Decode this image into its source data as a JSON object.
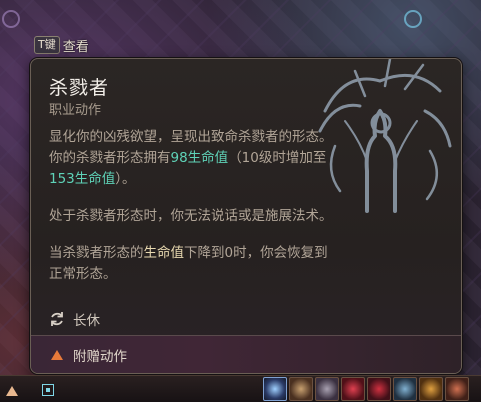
{
  "hint": {
    "key": "T键",
    "label": "查看"
  },
  "tooltip": {
    "title": "杀戮者",
    "subtitle": "职业动作",
    "desc1_a": "显化你的凶残欲望，呈现出致命杀戮者的形态。你的杀戮者形态拥有",
    "desc1_hp": "98生命值",
    "desc1_b": "（10级时增加至",
    "desc1_hp2": "153生命值",
    "desc1_c": "）。",
    "desc2": "处于杀戮者形态时，你无法说话或是施展法术。",
    "desc3_a": "当杀戮者形态的",
    "desc3_hp": "生命值",
    "desc3_b": "下降到0时，你会恢复到正常形态。",
    "rest_icon": "refresh-icon",
    "rest_label": "长休",
    "bonus_icon": "triangle-warning-icon",
    "bonus_label": "附赠动作"
  },
  "colors": {
    "highlight": "#5fd3b8",
    "bonus_icon": "#e87a3a",
    "border": "#6a5f55"
  },
  "hotbar": {
    "slots": [
      "sparkle-skill",
      "claw-skill",
      "beast-skill",
      "blood-skill",
      "blade-skill",
      "rune-skill",
      "spiral-skill",
      "dragon-skill"
    ]
  }
}
